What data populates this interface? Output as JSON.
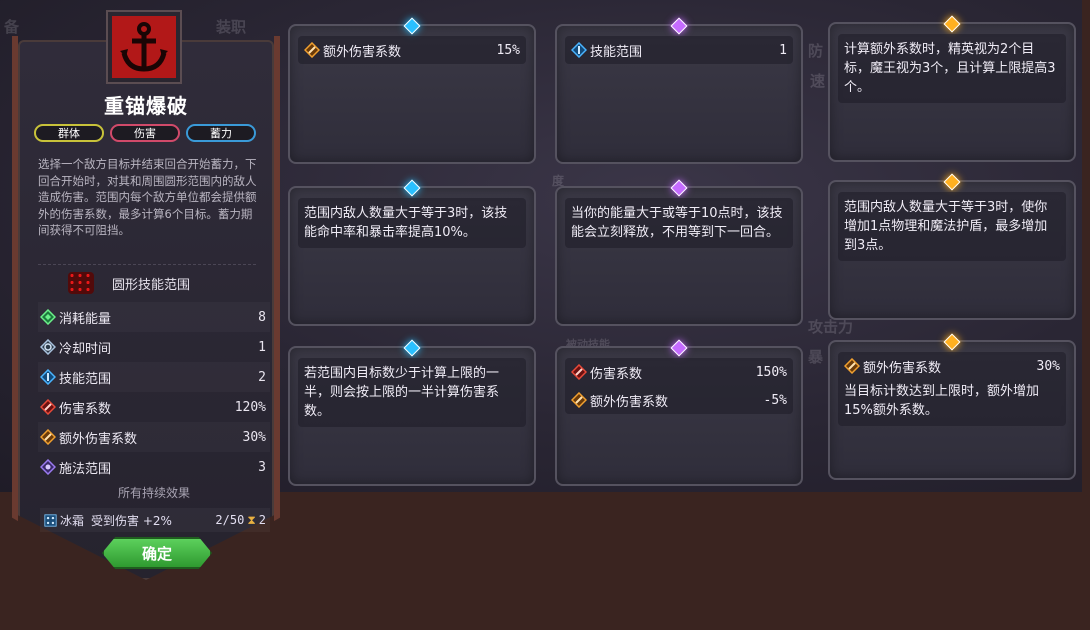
{
  "background": {
    "ghost_texts": [
      "备",
      "装职",
      "防",
      "速",
      "度",
      "被动技能",
      "攻击力",
      "暴"
    ]
  },
  "skill": {
    "icon": "anchor-icon",
    "title": "重锚爆破",
    "tags": [
      "群体",
      "伤害",
      "蓄力"
    ],
    "description": "选择一个敌方目标并结束回合开始蓄力，下回合开始时，对其和周围圆形范围内的敌人造成伤害。范围内每个敌方单位都会提供额外的伤害系数，最多计算6个目标。蓄力期间获得不可阻挡。",
    "range_label": "圆形技能范围",
    "stats": [
      {
        "icon": "energy-icon",
        "label": "消耗能量",
        "value": "8"
      },
      {
        "icon": "cooldown-icon",
        "label": "冷却时间",
        "value": "1"
      },
      {
        "icon": "skill-range-icon",
        "label": "技能范围",
        "value": "2"
      },
      {
        "icon": "damage-icon",
        "label": "伤害系数",
        "value": "120%"
      },
      {
        "icon": "extra-damage-icon",
        "label": "额外伤害系数",
        "value": "30%"
      },
      {
        "icon": "cast-range-icon",
        "label": "施法范围",
        "value": "3"
      }
    ],
    "lasting_title": "所有持续效果",
    "lasting_effect": {
      "name": "冰霜",
      "desc": "受到伤害 +2%",
      "stacks": "2/50",
      "turns": "2"
    },
    "confirm_label": "确定"
  },
  "cards": [
    {
      "gem": "blue",
      "lines": [
        {
          "icon": "extra-damage-icon",
          "label": "额外伤害系数",
          "value": "15%"
        }
      ]
    },
    {
      "gem": "purple",
      "lines": [
        {
          "icon": "skill-range-icon",
          "label": "技能范围",
          "value": "1"
        }
      ]
    },
    {
      "gem": "gold",
      "text": "计算额外系数时，精英视为2个目标，魔王视为3个，且计算上限提高3个。"
    },
    {
      "gem": "blue",
      "text": "范围内敌人数量大于等于3时，该技能命中率和暴击率提高10%。"
    },
    {
      "gem": "purple",
      "text": "当你的能量大于或等于10点时，该技能会立刻释放，不用等到下一回合。"
    },
    {
      "gem": "gold",
      "text": "范围内敌人数量大于等于3时，使你增加1点物理和魔法护盾，最多增加到3点。"
    },
    {
      "gem": "blue",
      "text": "若范围内目标数少于计算上限的一半，则会按上限的一半计算伤害系数。"
    },
    {
      "gem": "purple",
      "lines": [
        {
          "icon": "damage-icon",
          "label": "伤害系数",
          "value": "150%"
        },
        {
          "icon": "extra-damage-icon",
          "label": "额外伤害系数",
          "value": "-5%"
        }
      ]
    },
    {
      "gem": "gold",
      "lines": [
        {
          "icon": "extra-damage-icon",
          "label": "额外伤害系数",
          "value": "30%"
        }
      ],
      "text": "当目标计数达到上限时，额外增加15%额外系数。"
    }
  ],
  "colors": {
    "tag_group": "#c8c23a",
    "tag_damage": "#d14a6a",
    "tag_charge": "#3a9ad8",
    "confirm": "#3fae3f"
  }
}
